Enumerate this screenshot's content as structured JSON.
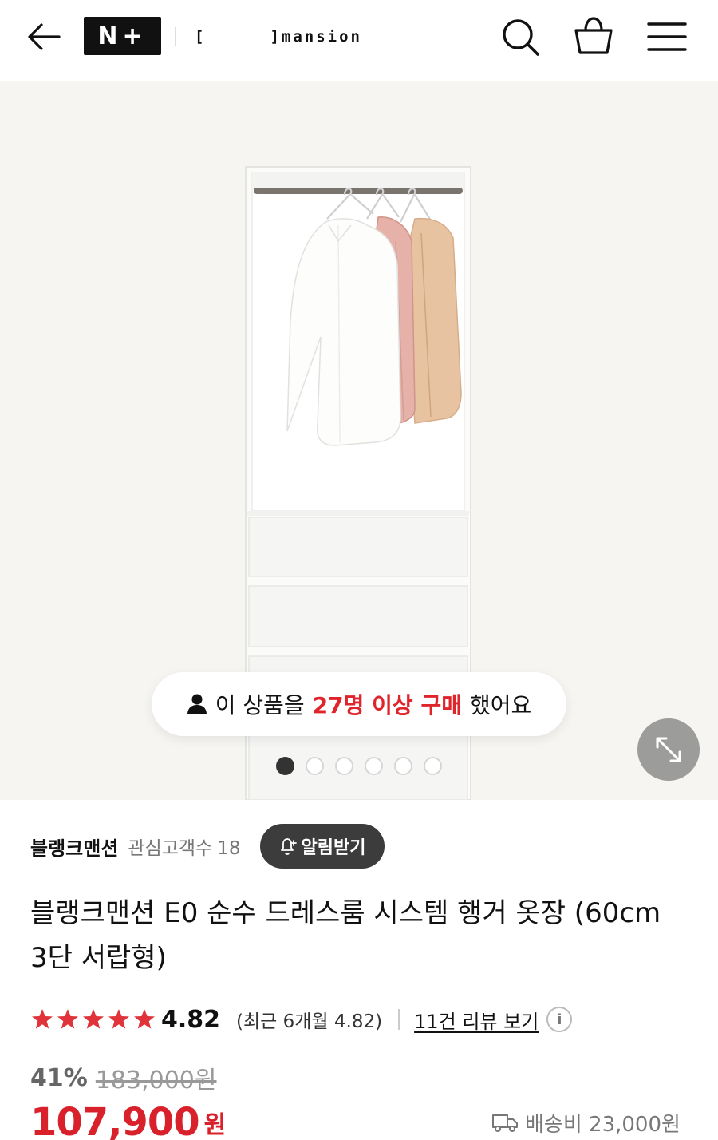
{
  "header": {
    "logo_mark": "N+",
    "brand_logo_left": "[",
    "brand_logo_right": "]mansion"
  },
  "gallery": {
    "buyer_text_pre": "이 상품을",
    "buyer_text_highlight": "27명 이상 구매",
    "buyer_text_post": "했어요",
    "highlight_color": "#e0242b",
    "image_count": 6,
    "active_index": 0
  },
  "seller": {
    "name": "블랭크맨션",
    "fans_label": "관심고객수",
    "fans_count": "18",
    "alarm_label": "알림받기"
  },
  "product": {
    "title": "블랭크맨션 E0 순수 드레스룸 시스템 행거 옷장 (60cm 3단 서랍형)",
    "rating": "4.82",
    "stars": 5,
    "recent_rating": "(최근 6개월 4.82)",
    "review_link": "11건 리뷰 보기",
    "discount": "41%",
    "original_price": "183,000원",
    "price": "107,900",
    "currency": "원",
    "shipping": "배송비 23,000원",
    "price_color": "#d8212a"
  }
}
